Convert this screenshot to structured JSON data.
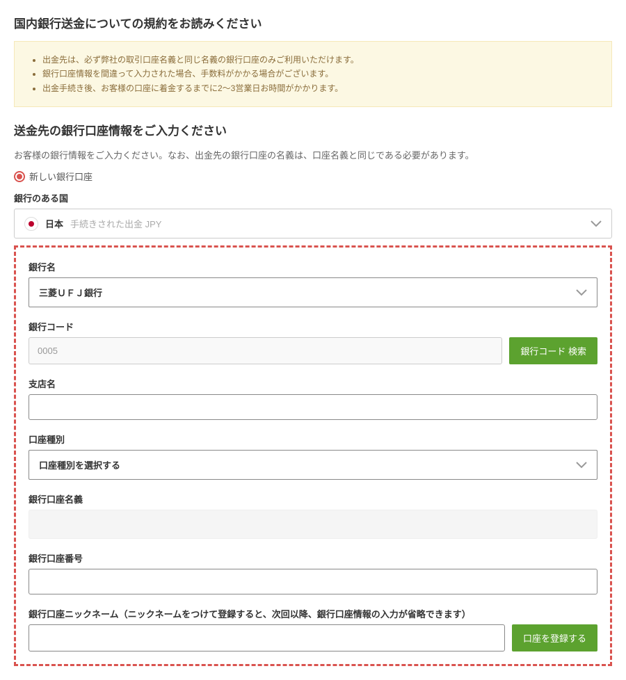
{
  "terms": {
    "heading": "国内銀行送金についての規約をお読みください",
    "notes": [
      "出金先は、必ず弊社の取引口座名義と同じ名義の銀行口座のみご利用いただけます。",
      "銀行口座情報を間違って入力された場合、手数料がかかる場合がございます。",
      "出金手続き後、お客様の口座に着金するまでに2～3営業日お時間がかかります。"
    ]
  },
  "bankinfo": {
    "heading": "送金先の銀行口座情報をご入力ください",
    "subtext": "お客様の銀行情報をご入力ください。なお、出金先の銀行口座の名義は、口座名義と同じである必要があります。",
    "radio_label": "新しい銀行口座",
    "country_label": "銀行のある国",
    "country_name": "日本",
    "country_hint": "手続きされた出金 JPY"
  },
  "form": {
    "bank_name_label": "銀行名",
    "bank_name_value": "三菱ＵＦＪ銀行",
    "bank_code_label": "銀行コード",
    "bank_code_value": "0005",
    "bank_code_search_btn": "銀行コード 検索",
    "branch_label": "支店名",
    "branch_value": "",
    "account_type_label": "口座種別",
    "account_type_placeholder": "口座種別を選択する",
    "account_holder_label": "銀行口座名義",
    "account_number_label": "銀行口座番号",
    "account_number_value": "",
    "nickname_label": "銀行口座ニックネーム（ニックネームをつけて登録すると、次回以降、銀行口座情報の入力が省略できます）",
    "nickname_value": "",
    "register_btn": "口座を登録する"
  }
}
